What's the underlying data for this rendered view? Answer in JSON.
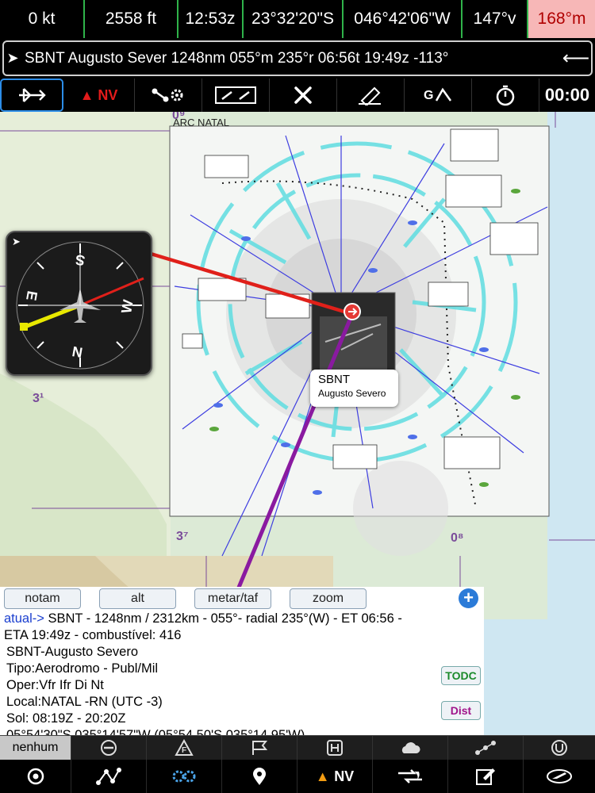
{
  "status": {
    "speed": "0 kt",
    "altitude": "2558 ft",
    "time": "12:53z",
    "latitude": "23°32'20\"S",
    "longitude": "046°42'06\"W",
    "track": "147°v",
    "heading": "168°m"
  },
  "route": {
    "text": "SBNT Augusto Sever  1248nm  055°m  235°r  06:56t  19:49z  -113°"
  },
  "toolbar": {
    "nv_label": "NV",
    "timer": "00:00"
  },
  "map": {
    "callout_code": "SBNT",
    "callout_name": "Augusto Severo",
    "chart_title": "ARC NATAL"
  },
  "info": {
    "tabs": [
      "notam",
      "alt",
      "metar/taf",
      "zoom"
    ],
    "line1_prefix": "atual->",
    "line1": " SBNT - 1248nm /  2312km - 055°- radial 235°(W) - ET 06:56 -",
    "line2": "ETA 19:49z - combustível:    416",
    "line3": "SBNT-Augusto Severo",
    "line4": "Tipo:Aerodromo - Publ/Mil",
    "line5": "Oper:Vfr Ifr Di Nt",
    "line6": "Local:NATAL -RN (UTC -3)",
    "line7": "Sol: 08:19Z - 20:20Z",
    "line8": "05°54'30\"S  035°14'57\"W (05°54.50'S  035°14.95'W)",
    "todc_label": "TODC",
    "dist_label": "Dist"
  },
  "layerbar": {
    "selected_label": "nenhum"
  },
  "navbar": {
    "nv_label": "NV"
  },
  "colors": {
    "accent_green": "#2fb34a",
    "heading_bg": "#f7b7b7",
    "route_red": "#e0201a",
    "route_purple": "#8a1aa0",
    "airspace_cyan": "#4fd6dc",
    "selection_blue": "#2c8de8"
  }
}
